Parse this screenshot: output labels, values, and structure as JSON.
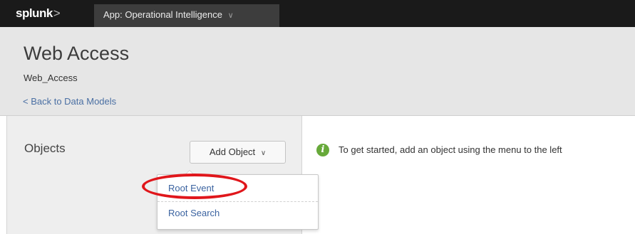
{
  "topbar": {
    "logo_text": "splunk",
    "logo_chevron": ">",
    "app_menu_label": "App: Operational Intelligence",
    "app_menu_caret": "∨"
  },
  "header": {
    "title": "Web Access",
    "subtitle": "Web_Access",
    "back_link": "< Back to Data Models"
  },
  "sidebar": {
    "heading": "Objects",
    "add_button_label": "Add Object",
    "add_button_caret": "∨"
  },
  "dropdown": {
    "items": [
      {
        "label": "Root Event",
        "highlighted": true
      },
      {
        "label": "Root Search"
      }
    ],
    "highlight_color": "#e0161b"
  },
  "main": {
    "info_icon": "i",
    "info_text": "To get started, add an object using the menu to the left"
  },
  "colors": {
    "topbar": "#1a1a1a",
    "header": "#e6e6e6",
    "link": "#3b63a0",
    "info_icon": "#67a93a"
  }
}
